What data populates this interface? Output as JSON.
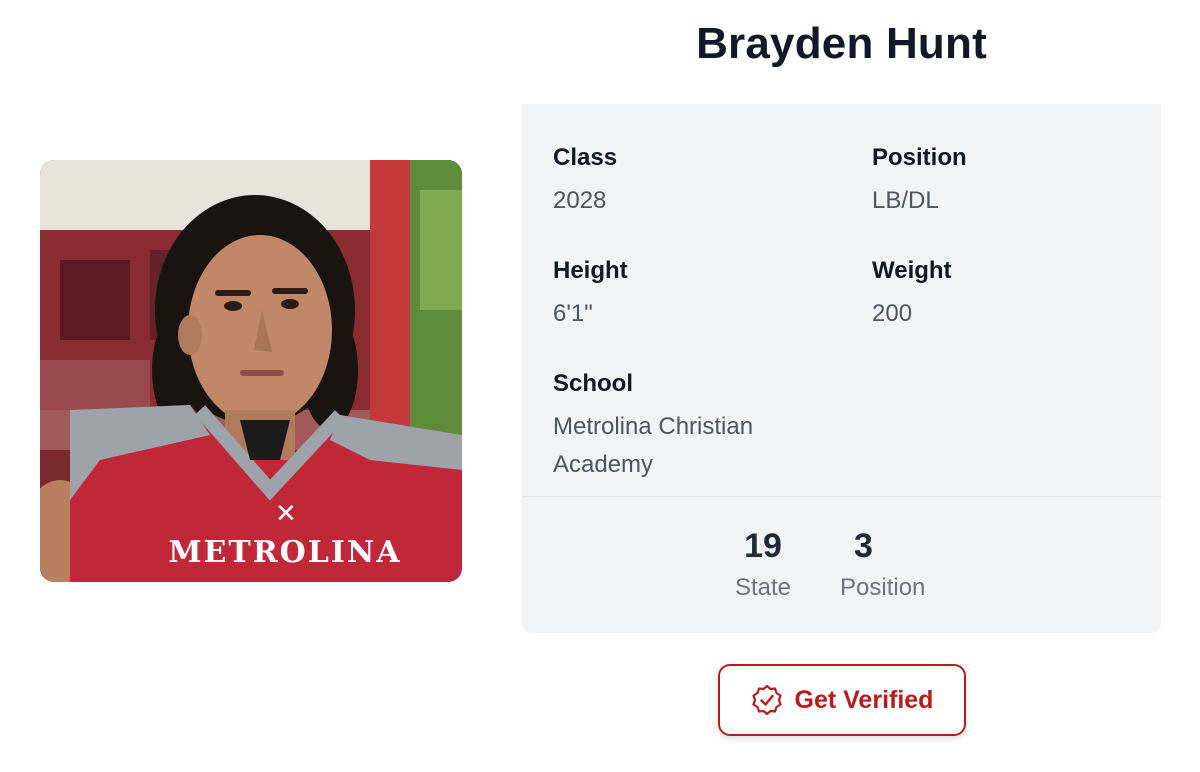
{
  "player": {
    "name": "Brayden Hunt"
  },
  "details": {
    "class_label": "Class",
    "class_value": "2028",
    "position_label": "Position",
    "position_value": "LB/DL",
    "height_label": "Height",
    "height_value": "6'1\"",
    "weight_label": "Weight",
    "weight_value": "200",
    "school_label": "School",
    "school_value": "Metrolina Christian Academy"
  },
  "rankings": [
    {
      "value": "19",
      "label": "State"
    },
    {
      "value": "3",
      "label": "Position"
    }
  ],
  "photo": {
    "jersey_text": "METROLINA",
    "jersey_color": "#c0283a"
  },
  "actions": {
    "verify_label": "Get Verified",
    "verify_icon": "verified-badge-icon",
    "accent_color": "#b91c1c"
  }
}
